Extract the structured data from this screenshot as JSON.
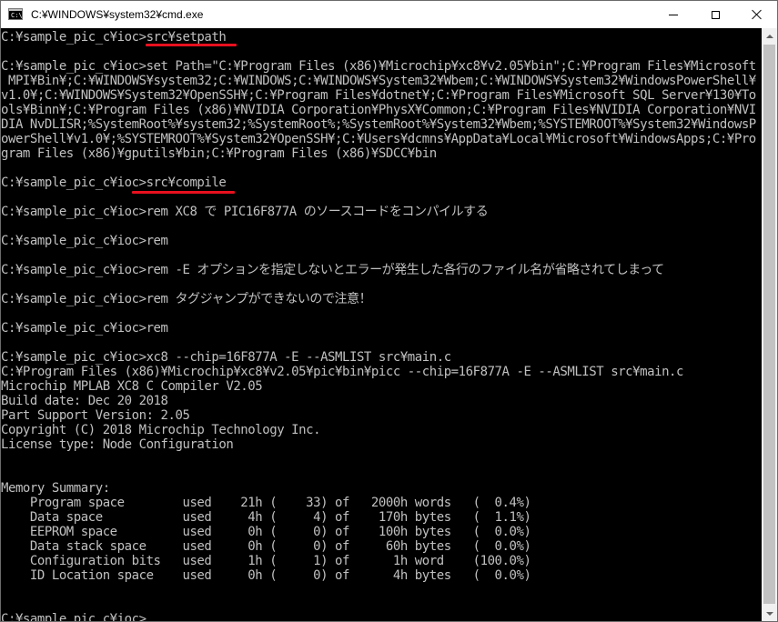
{
  "window": {
    "title": "C:¥WINDOWS¥system32¥cmd.exe",
    "app_icon": "cmd-icon",
    "icon_prompt": "C:\\",
    "controls": {
      "minimize_icon": "minimize-icon",
      "maximize_icon": "maximize-icon",
      "close_icon": "close-icon"
    }
  },
  "colors": {
    "console_bg": "#000000",
    "console_text": "#c0c0c0",
    "annotation_underline": "#e8101e",
    "titlebar_bg": "#ffffff",
    "scrollbar_bg": "#f0f0f0"
  },
  "console": {
    "lines": [
      "C:¥sample_pic_c¥ioc>src¥setpath",
      "",
      "C:¥sample_pic_c¥ioc>set Path=\"C:¥Program Files (x86)¥Microchip¥xc8¥v2.05¥bin\";C:¥Program Files¥Microsoft",
      " MPI¥Bin¥;C:¥WINDOWS¥system32;C:¥WINDOWS;C:¥WINDOWS¥System32¥Wbem;C:¥WINDOWS¥System32¥WindowsPowerShell¥",
      "v1.0¥;C:¥WINDOWS¥System32¥OpenSSH¥;C:¥Program Files¥dotnet¥;C:¥Program Files¥Microsoft SQL Server¥130¥To",
      "ols¥Binn¥;C:¥Program Files (x86)¥NVIDIA Corporation¥PhysX¥Common;C:¥Program Files¥NVIDIA Corporation¥NVI",
      "DIA NvDLISR;%SystemRoot%¥system32;%SystemRoot%;%SystemRoot%¥System32¥Wbem;%SYSTEMROOT%¥System32¥WindowsP",
      "owerShell¥v1.0¥;%SYSTEMROOT%¥System32¥OpenSSH¥;C:¥Users¥dcmns¥AppData¥Local¥Microsoft¥WindowsApps;C:¥Pro",
      "gram Files (x86)¥gputils¥bin;C:¥Program Files (x86)¥SDCC¥bin",
      "",
      "C:¥sample_pic_c¥ioc>src¥compile",
      "",
      "C:¥sample_pic_c¥ioc>rem XC8 で PIC16F877A のソースコードをコンパイルする",
      "",
      "C:¥sample_pic_c¥ioc>rem",
      "",
      "C:¥sample_pic_c¥ioc>rem -E オプションを指定しないとエラーが発生した各行のファイル名が省略されてしまって",
      "",
      "C:¥sample_pic_c¥ioc>rem タグジャンプができないので注意！",
      "",
      "C:¥sample_pic_c¥ioc>rem",
      "",
      "C:¥sample_pic_c¥ioc>xc8 --chip=16F877A -E --ASMLIST src¥main.c",
      "C:¥Program Files (x86)¥Microchip¥xc8¥v2.05¥pic¥bin¥picc --chip=16F877A -E --ASMLIST src¥main.c",
      "Microchip MPLAB XC8 C Compiler V2.05",
      "Build date: Dec 20 2018",
      "Part Support Version: 2.05",
      "Copyright (C) 2018 Microchip Technology Inc.",
      "License type: Node Configuration",
      "",
      "",
      "Memory Summary:",
      "    Program space        used    21h (    33) of   2000h words   (  0.4%)",
      "    Data space           used     4h (     4) of    170h bytes   (  1.1%)",
      "    EEPROM space         used     0h (     0) of    100h bytes   (  0.0%)",
      "    Data stack space     used     0h (     0) of     60h bytes   (  0.0%)",
      "    Configuration bits   used     1h (     1) of      1h word    (100.0%)",
      "    ID Location space    used     0h (     0) of      4h bytes   (  0.0%)",
      "",
      "",
      "C:¥sample_pic_c¥ioc>"
    ]
  }
}
